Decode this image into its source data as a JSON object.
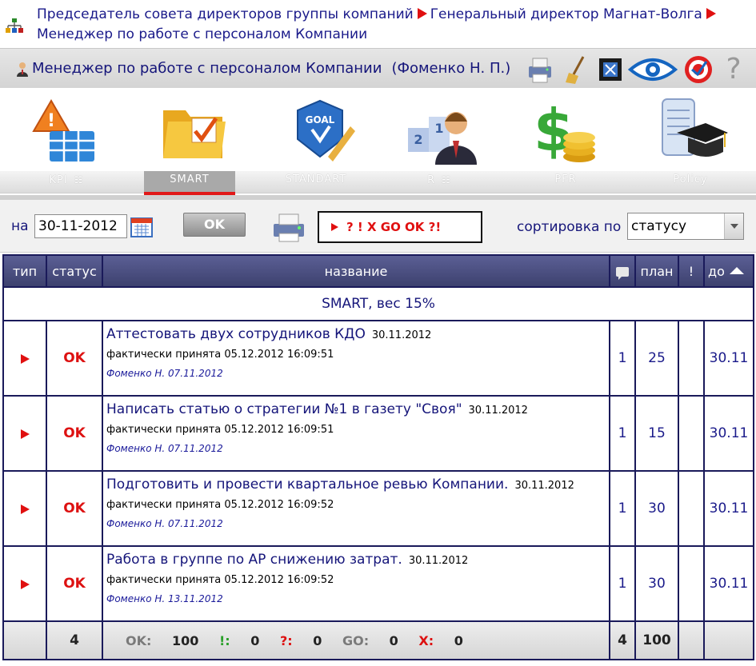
{
  "breadcrumb": {
    "items": [
      "Председатель совета директоров группы компаний",
      "Генеральный директор Магнат-Волга",
      "Менеджер по работе с персоналом Компании"
    ]
  },
  "header": {
    "title": "Менеджер по работе с персоналом Компании",
    "person": "(Фоменко Н. П.)",
    "tools": [
      "printer-icon",
      "broom-icon",
      "screen-icon",
      "eye-icon",
      "target-icon",
      "help-icon"
    ],
    "help_label": "?"
  },
  "modules": [
    {
      "icon": "kpi-icon",
      "label": "KPI",
      "has_grid": true,
      "active": false
    },
    {
      "icon": "folder-icon",
      "label": "SMART",
      "has_grid": false,
      "active": true
    },
    {
      "icon": "goal-icon",
      "label": "STANDART",
      "has_grid": false,
      "active": false
    },
    {
      "icon": "ranking-icon",
      "label": "R",
      "has_grid": true,
      "active": false
    },
    {
      "icon": "money-icon",
      "label": "PFR",
      "has_grid": false,
      "active": false
    },
    {
      "icon": "diploma-icon",
      "label": "Policy",
      "has_grid": false,
      "active": false
    }
  ],
  "grid_glyph": "☷",
  "filter": {
    "date_label": "на",
    "date_value": "30-11-2012",
    "ok_label": "OK",
    "legend": "? ! X GO OK ?!",
    "sort_label": "сортировка по",
    "sort_value": "статусу"
  },
  "table": {
    "columns": {
      "type": "тип",
      "status": "статус",
      "name": "название",
      "plan": "план",
      "alert": "!",
      "due": "до"
    },
    "group": "SMART, вес 15%",
    "rows": [
      {
        "status": "OK",
        "title": "Аттестовать двух сотрудников КДО",
        "date": "30.11.2012",
        "accepted": "фактически принята 05.12.2012 16:09:51",
        "author": "Фоменко Н. 07.11.2012",
        "comments": "1",
        "plan": "25",
        "alert": "",
        "due": "30.11"
      },
      {
        "status": "OK",
        "title": "Написать статью о стратегии №1 в газету \"Своя\"",
        "date": "30.11.2012",
        "accepted": "фактически принята 05.12.2012 16:09:51",
        "author": "Фоменко Н. 07.11.2012",
        "comments": "1",
        "plan": "15",
        "alert": "",
        "due": "30.11"
      },
      {
        "status": "OK",
        "title": "Подготовить и провести квартальное ревью Компании.",
        "date": "30.11.2012",
        "accepted": "фактически принята 05.12.2012 16:09:52",
        "author": "Фоменко Н. 07.11.2012",
        "comments": "1",
        "plan": "30",
        "alert": "",
        "due": "30.11"
      },
      {
        "status": "OK",
        "title": "Работа в группе по АР снижению затрат.",
        "date": "30.11.2012",
        "accepted": "фактически принята 05.12.2012 16:09:52",
        "author": "Фоменко Н. 13.11.2012",
        "comments": "1",
        "plan": "30",
        "alert": "",
        "due": "30.11"
      }
    ],
    "footer": {
      "count": "4",
      "stats": {
        "ok_label": "OK:",
        "ok_value": "100",
        "excl_label": "!:",
        "excl_value": "0",
        "q_label": "?:",
        "q_value": "0",
        "go_label": "GO:",
        "go_value": "0",
        "x_label": "X:",
        "x_value": "0"
      },
      "comments_total": "4",
      "plan_total": "100"
    }
  },
  "colors": {
    "header_blue": "#3d416f",
    "text_blue": "#15157a",
    "status_red": "#dd1111",
    "accent_green": "#2aa02a"
  }
}
